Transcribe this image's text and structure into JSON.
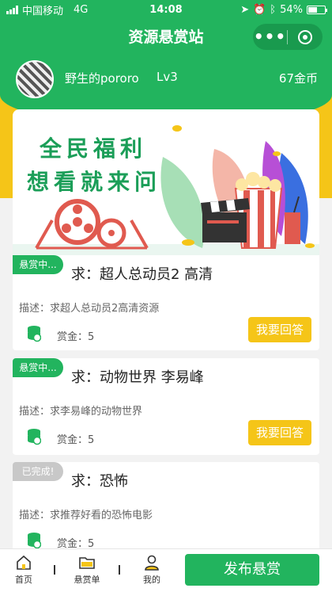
{
  "status_bar": {
    "carrier": "中国移动",
    "network": "4G",
    "time": "14:08",
    "battery": "54%",
    "battery_level": 0.54
  },
  "header": {
    "title": "资源悬赏站",
    "more_icon": "more-dots-icon",
    "close_icon": "target-icon"
  },
  "user": {
    "name": "野生的pororo",
    "level": "Lv3",
    "coins": "67金币"
  },
  "banner": {
    "line1": "全民福利",
    "line2": "想看就来问"
  },
  "bounties": [
    {
      "status": "悬赏中...",
      "title": "求：超人总动员2 高清",
      "desc": "描述：求超人总动员2高清资源",
      "reward": "赏金：5",
      "button": "我要回答"
    },
    {
      "status": "悬赏中...",
      "title": "求：动物世界 李易峰",
      "desc": "描述：求李易峰的动物世界",
      "reward": "赏金：5",
      "button": "我要回答"
    },
    {
      "status": "已完成!",
      "title": "求：恐怖",
      "desc": "描述：求推荐好看的恐怖电影",
      "reward": "赏金：5"
    }
  ],
  "tabbar": {
    "home": "首页",
    "orders": "悬赏单",
    "me": "我的",
    "publish": "发布悬赏"
  },
  "colors": {
    "primary_green": "#22b45e",
    "accent_yellow": "#f5c518",
    "completed_grey": "#c8c8c8"
  }
}
